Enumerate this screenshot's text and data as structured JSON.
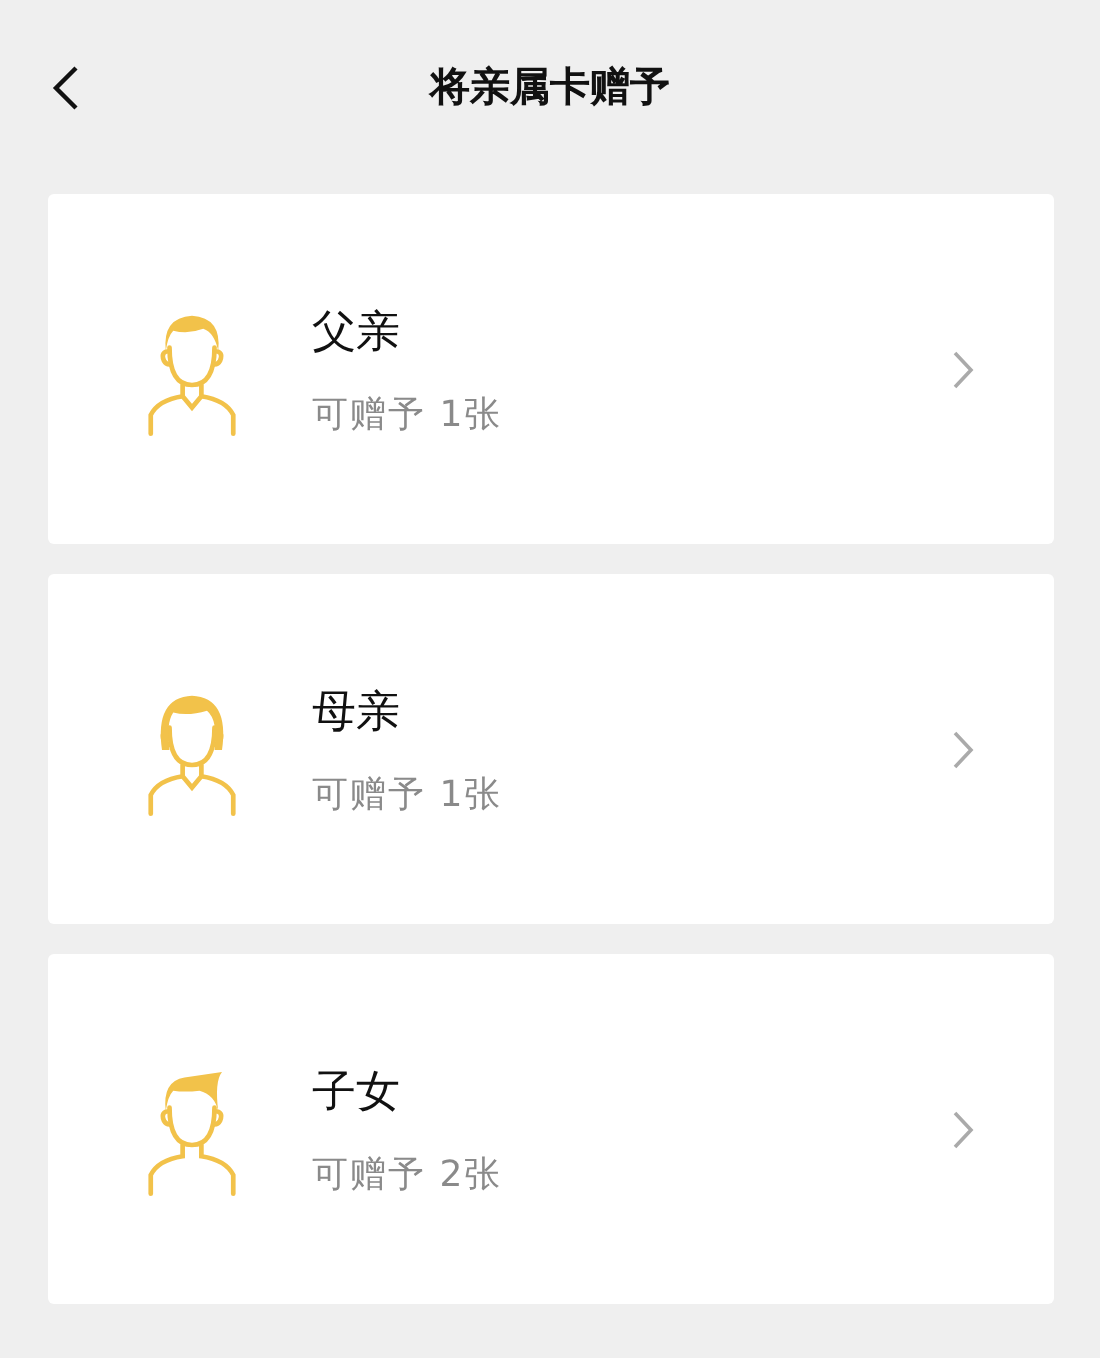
{
  "header": {
    "title": "将亲属卡赠予"
  },
  "members": [
    {
      "kind": "father",
      "name": "父亲",
      "note": "可赠予 1张"
    },
    {
      "kind": "mother",
      "name": "母亲",
      "note": "可赠予 1张"
    },
    {
      "kind": "child",
      "name": "子女",
      "note": "可赠予 2张"
    }
  ]
}
